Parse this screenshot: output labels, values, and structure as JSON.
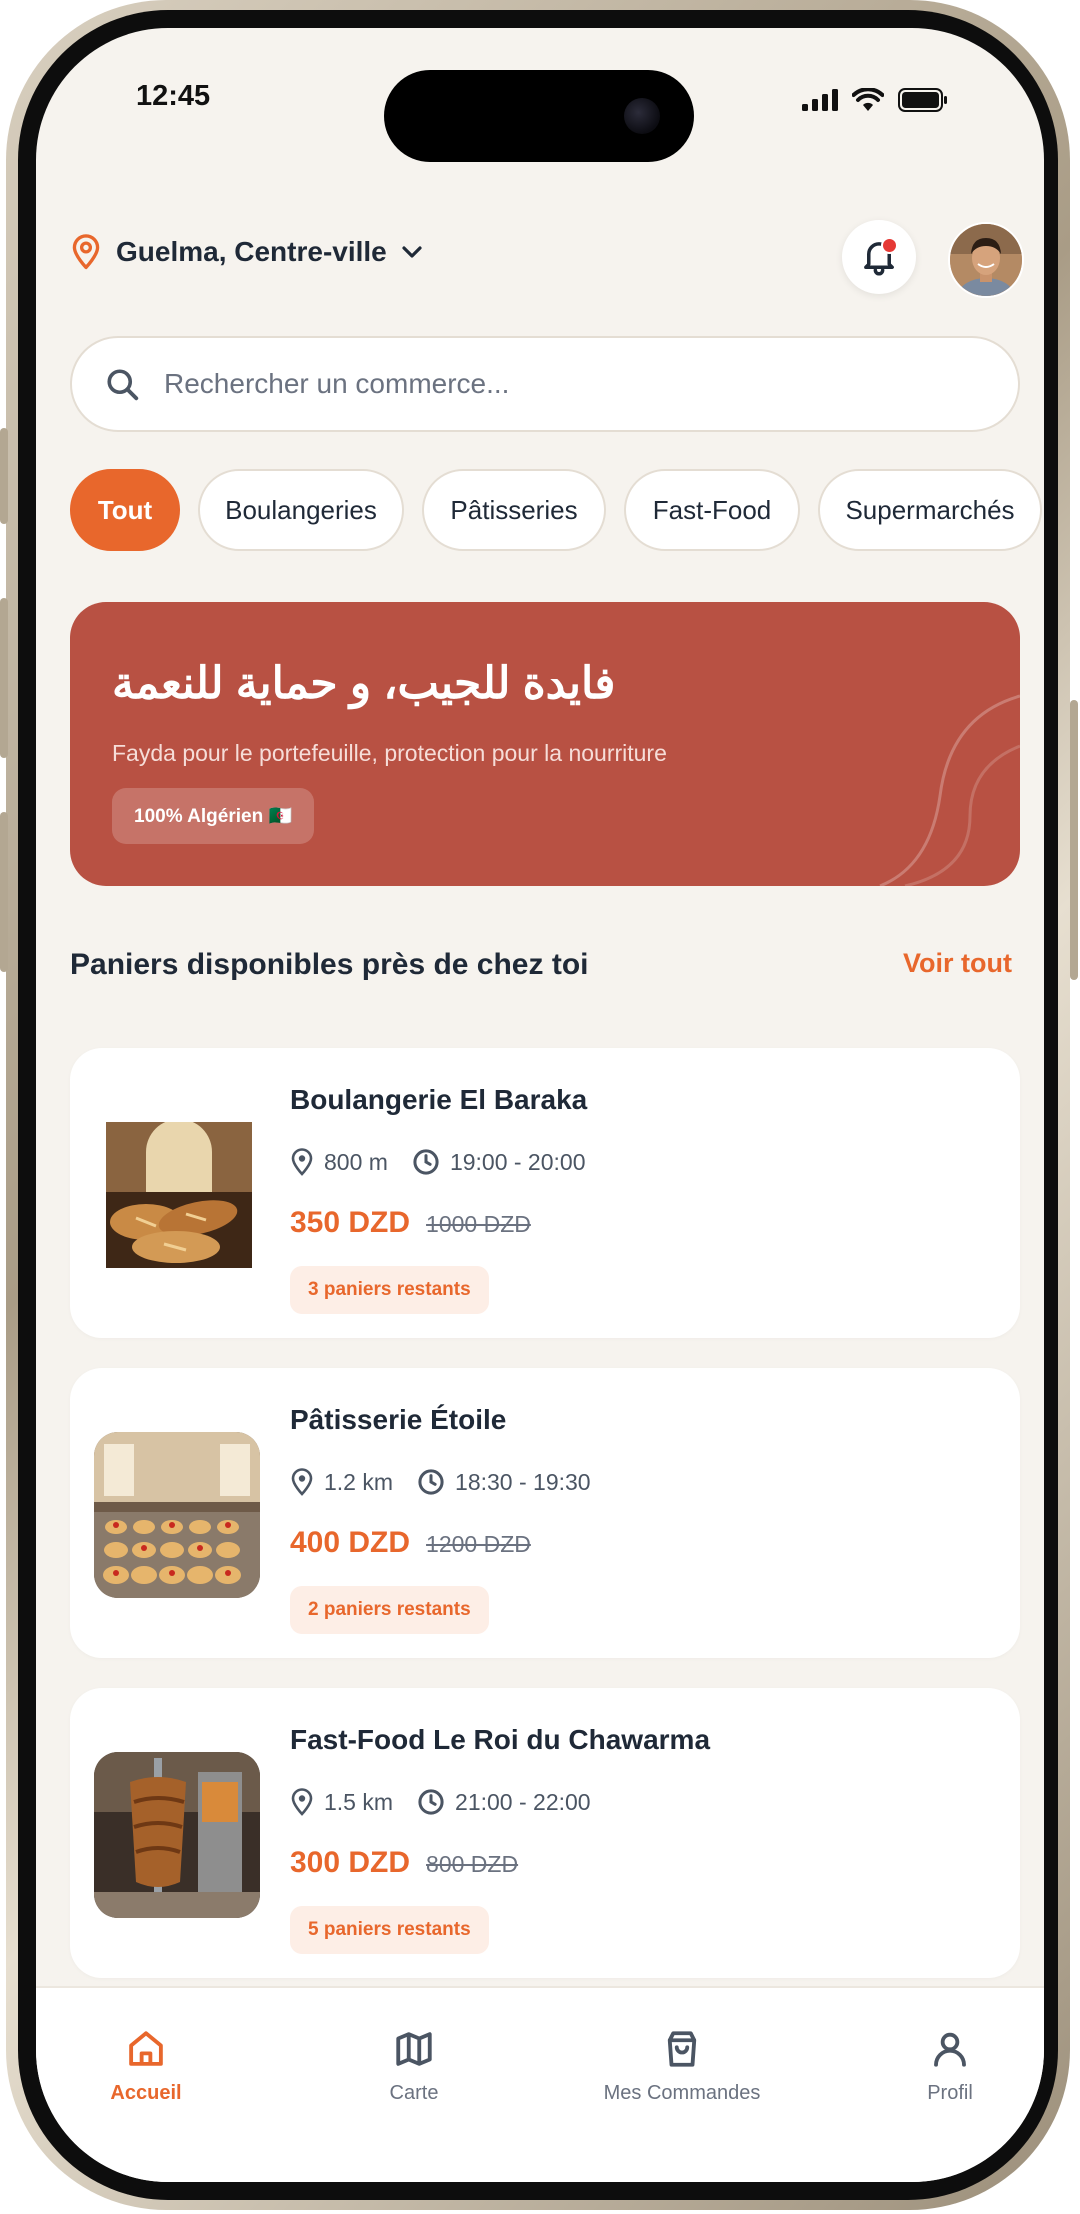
{
  "status_bar": {
    "time": "12:45"
  },
  "header": {
    "location": "Guelma, Centre-ville",
    "has_notification": true
  },
  "search": {
    "placeholder": "Rechercher un commerce..."
  },
  "categories": [
    {
      "label": "Tout",
      "active": true
    },
    {
      "label": "Boulangeries",
      "active": false
    },
    {
      "label": "Pâtisseries",
      "active": false
    },
    {
      "label": "Fast-Food",
      "active": false
    },
    {
      "label": "Supermarchés",
      "active": false
    }
  ],
  "banner": {
    "title": "فايدة للجيب، و حماية للنعمة",
    "subtitle": "Fayda pour le portefeuille, protection pour la nourriture",
    "badge": "100% Algérien 🇩🇿"
  },
  "section": {
    "title": "Paniers disponibles près de chez toi",
    "see_all": "Voir tout"
  },
  "stores": [
    {
      "name": "Boulangerie El Baraka",
      "distance": "800 m",
      "time": "19:00 - 20:00",
      "price": "350 DZD",
      "old_price": "1000 DZD",
      "remaining": "3 paniers restants"
    },
    {
      "name": "Pâtisserie Étoile",
      "distance": "1.2 km",
      "time": "18:30 - 19:30",
      "price": "400 DZD",
      "old_price": "1200 DZD",
      "remaining": "2 paniers restants"
    },
    {
      "name": "Fast-Food Le Roi du Chawarma",
      "distance": "1.5 km",
      "time": "21:00 - 22:00",
      "price": "300 DZD",
      "old_price": "800 DZD",
      "remaining": "5 paniers restants"
    }
  ],
  "nav": [
    {
      "label": "Accueil",
      "icon": "home-icon",
      "active": true
    },
    {
      "label": "Carte",
      "icon": "map-icon",
      "active": false
    },
    {
      "label": "Mes Commandes",
      "icon": "shopping-bag-icon",
      "active": false
    },
    {
      "label": "Profil",
      "icon": "user-icon",
      "active": false
    }
  ],
  "colors": {
    "accent": "#e8672c",
    "banner": "#b85143",
    "background": "#f6f3ee"
  }
}
